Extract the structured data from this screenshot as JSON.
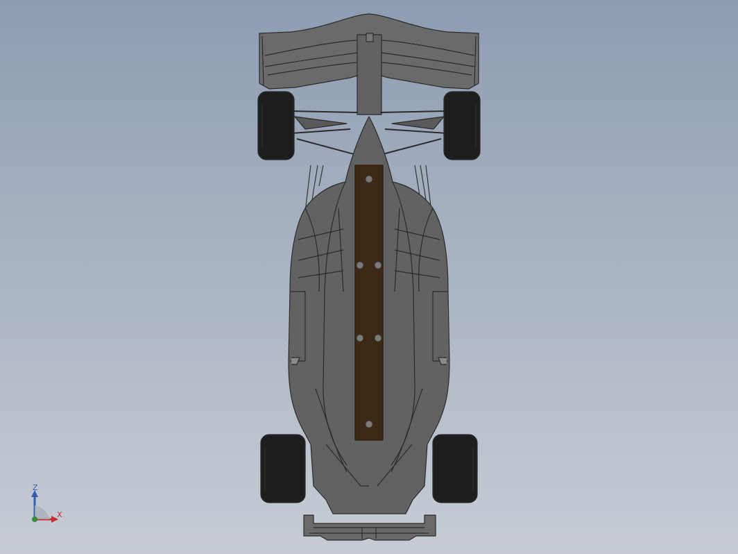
{
  "viewport": {
    "background_top": "#8e9cb2",
    "background_bottom": "#c7ccd4"
  },
  "model": {
    "name": "f1-car-top-view",
    "body_color": "#5e5e5e",
    "edge_color": "#2b2b2b",
    "tire_color": "#1e1e1e",
    "plank_color": "#3d2916",
    "bolt_color": "#7a7a7a"
  },
  "triad": {
    "z_label": "Z",
    "x_label": "X",
    "z_color": "#2f5fb0",
    "x_color": "#c03030",
    "y_color": "#3a8a3a"
  }
}
